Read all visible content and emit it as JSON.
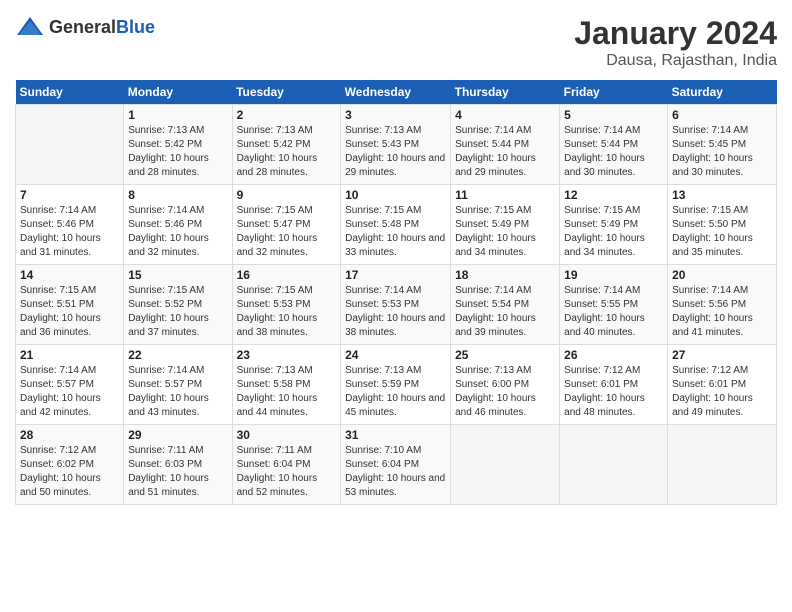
{
  "header": {
    "logo_general": "General",
    "logo_blue": "Blue",
    "title": "January 2024",
    "subtitle": "Dausa, Rajasthan, India"
  },
  "weekdays": [
    "Sunday",
    "Monday",
    "Tuesday",
    "Wednesday",
    "Thursday",
    "Friday",
    "Saturday"
  ],
  "weeks": [
    [
      {
        "day": "",
        "sunrise": "",
        "sunset": "",
        "daylight": ""
      },
      {
        "day": "1",
        "sunrise": "Sunrise: 7:13 AM",
        "sunset": "Sunset: 5:42 PM",
        "daylight": "Daylight: 10 hours and 28 minutes."
      },
      {
        "day": "2",
        "sunrise": "Sunrise: 7:13 AM",
        "sunset": "Sunset: 5:42 PM",
        "daylight": "Daylight: 10 hours and 28 minutes."
      },
      {
        "day": "3",
        "sunrise": "Sunrise: 7:13 AM",
        "sunset": "Sunset: 5:43 PM",
        "daylight": "Daylight: 10 hours and 29 minutes."
      },
      {
        "day": "4",
        "sunrise": "Sunrise: 7:14 AM",
        "sunset": "Sunset: 5:44 PM",
        "daylight": "Daylight: 10 hours and 29 minutes."
      },
      {
        "day": "5",
        "sunrise": "Sunrise: 7:14 AM",
        "sunset": "Sunset: 5:44 PM",
        "daylight": "Daylight: 10 hours and 30 minutes."
      },
      {
        "day": "6",
        "sunrise": "Sunrise: 7:14 AM",
        "sunset": "Sunset: 5:45 PM",
        "daylight": "Daylight: 10 hours and 30 minutes."
      }
    ],
    [
      {
        "day": "7",
        "sunrise": "Sunrise: 7:14 AM",
        "sunset": "Sunset: 5:46 PM",
        "daylight": "Daylight: 10 hours and 31 minutes."
      },
      {
        "day": "8",
        "sunrise": "Sunrise: 7:14 AM",
        "sunset": "Sunset: 5:46 PM",
        "daylight": "Daylight: 10 hours and 32 minutes."
      },
      {
        "day": "9",
        "sunrise": "Sunrise: 7:15 AM",
        "sunset": "Sunset: 5:47 PM",
        "daylight": "Daylight: 10 hours and 32 minutes."
      },
      {
        "day": "10",
        "sunrise": "Sunrise: 7:15 AM",
        "sunset": "Sunset: 5:48 PM",
        "daylight": "Daylight: 10 hours and 33 minutes."
      },
      {
        "day": "11",
        "sunrise": "Sunrise: 7:15 AM",
        "sunset": "Sunset: 5:49 PM",
        "daylight": "Daylight: 10 hours and 34 minutes."
      },
      {
        "day": "12",
        "sunrise": "Sunrise: 7:15 AM",
        "sunset": "Sunset: 5:49 PM",
        "daylight": "Daylight: 10 hours and 34 minutes."
      },
      {
        "day": "13",
        "sunrise": "Sunrise: 7:15 AM",
        "sunset": "Sunset: 5:50 PM",
        "daylight": "Daylight: 10 hours and 35 minutes."
      }
    ],
    [
      {
        "day": "14",
        "sunrise": "Sunrise: 7:15 AM",
        "sunset": "Sunset: 5:51 PM",
        "daylight": "Daylight: 10 hours and 36 minutes."
      },
      {
        "day": "15",
        "sunrise": "Sunrise: 7:15 AM",
        "sunset": "Sunset: 5:52 PM",
        "daylight": "Daylight: 10 hours and 37 minutes."
      },
      {
        "day": "16",
        "sunrise": "Sunrise: 7:15 AM",
        "sunset": "Sunset: 5:53 PM",
        "daylight": "Daylight: 10 hours and 38 minutes."
      },
      {
        "day": "17",
        "sunrise": "Sunrise: 7:14 AM",
        "sunset": "Sunset: 5:53 PM",
        "daylight": "Daylight: 10 hours and 38 minutes."
      },
      {
        "day": "18",
        "sunrise": "Sunrise: 7:14 AM",
        "sunset": "Sunset: 5:54 PM",
        "daylight": "Daylight: 10 hours and 39 minutes."
      },
      {
        "day": "19",
        "sunrise": "Sunrise: 7:14 AM",
        "sunset": "Sunset: 5:55 PM",
        "daylight": "Daylight: 10 hours and 40 minutes."
      },
      {
        "day": "20",
        "sunrise": "Sunrise: 7:14 AM",
        "sunset": "Sunset: 5:56 PM",
        "daylight": "Daylight: 10 hours and 41 minutes."
      }
    ],
    [
      {
        "day": "21",
        "sunrise": "Sunrise: 7:14 AM",
        "sunset": "Sunset: 5:57 PM",
        "daylight": "Daylight: 10 hours and 42 minutes."
      },
      {
        "day": "22",
        "sunrise": "Sunrise: 7:14 AM",
        "sunset": "Sunset: 5:57 PM",
        "daylight": "Daylight: 10 hours and 43 minutes."
      },
      {
        "day": "23",
        "sunrise": "Sunrise: 7:13 AM",
        "sunset": "Sunset: 5:58 PM",
        "daylight": "Daylight: 10 hours and 44 minutes."
      },
      {
        "day": "24",
        "sunrise": "Sunrise: 7:13 AM",
        "sunset": "Sunset: 5:59 PM",
        "daylight": "Daylight: 10 hours and 45 minutes."
      },
      {
        "day": "25",
        "sunrise": "Sunrise: 7:13 AM",
        "sunset": "Sunset: 6:00 PM",
        "daylight": "Daylight: 10 hours and 46 minutes."
      },
      {
        "day": "26",
        "sunrise": "Sunrise: 7:12 AM",
        "sunset": "Sunset: 6:01 PM",
        "daylight": "Daylight: 10 hours and 48 minutes."
      },
      {
        "day": "27",
        "sunrise": "Sunrise: 7:12 AM",
        "sunset": "Sunset: 6:01 PM",
        "daylight": "Daylight: 10 hours and 49 minutes."
      }
    ],
    [
      {
        "day": "28",
        "sunrise": "Sunrise: 7:12 AM",
        "sunset": "Sunset: 6:02 PM",
        "daylight": "Daylight: 10 hours and 50 minutes."
      },
      {
        "day": "29",
        "sunrise": "Sunrise: 7:11 AM",
        "sunset": "Sunset: 6:03 PM",
        "daylight": "Daylight: 10 hours and 51 minutes."
      },
      {
        "day": "30",
        "sunrise": "Sunrise: 7:11 AM",
        "sunset": "Sunset: 6:04 PM",
        "daylight": "Daylight: 10 hours and 52 minutes."
      },
      {
        "day": "31",
        "sunrise": "Sunrise: 7:10 AM",
        "sunset": "Sunset: 6:04 PM",
        "daylight": "Daylight: 10 hours and 53 minutes."
      },
      {
        "day": "",
        "sunrise": "",
        "sunset": "",
        "daylight": ""
      },
      {
        "day": "",
        "sunrise": "",
        "sunset": "",
        "daylight": ""
      },
      {
        "day": "",
        "sunrise": "",
        "sunset": "",
        "daylight": ""
      }
    ]
  ]
}
